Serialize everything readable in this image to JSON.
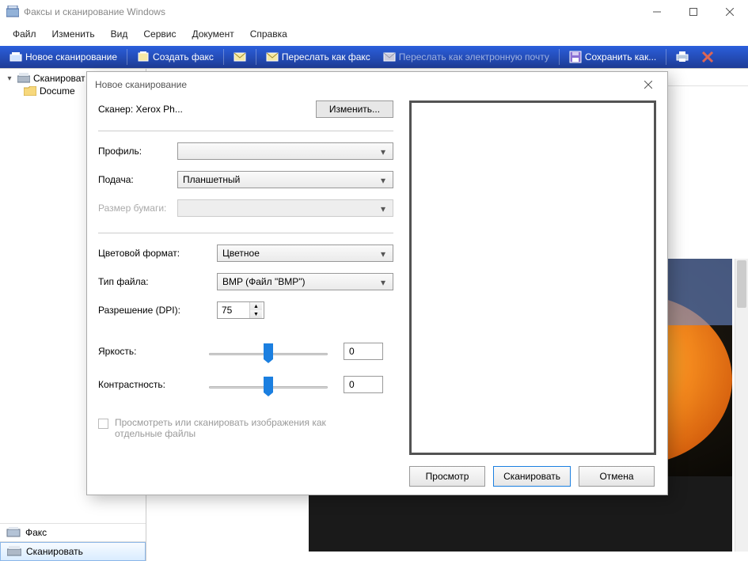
{
  "app": {
    "title": "Факсы и сканирование Windows"
  },
  "menu": {
    "items": [
      "Файл",
      "Изменить",
      "Вид",
      "Сервис",
      "Документ",
      "Справка"
    ]
  },
  "toolbar": {
    "new_scan": "Новое сканирование",
    "new_fax": "Создать факс",
    "fwd_fax": "Переслать как факс",
    "fwd_email": "Переслать как электронную почту",
    "save_as": "Сохранить как..."
  },
  "tree": {
    "scan_root": "Сканироват",
    "documents": "Docume"
  },
  "modes": {
    "fax": "Факс",
    "scan": "Сканировать"
  },
  "dialog": {
    "title": "Новое сканирование",
    "scanner_label": "Сканер: Xerox Ph...",
    "change": "Изменить...",
    "profile": "Профиль:",
    "feed": "Подача:",
    "feed_value": "Планшетный",
    "paper_size": "Размер бумаги:",
    "color_format": "Цветовой формат:",
    "color_value": "Цветное",
    "file_type": "Тип файла:",
    "file_value": "BMP (Файл \"BMP\")",
    "dpi": "Разрешение (DPI):",
    "dpi_value": "75",
    "brightness": "Яркость:",
    "brightness_value": "0",
    "contrast": "Контрастность:",
    "contrast_value": "0",
    "separate_files": "Просмотреть или сканировать изображения как отдельные файлы",
    "preview": "Просмотр",
    "scan": "Сканировать",
    "cancel": "Отмена"
  }
}
